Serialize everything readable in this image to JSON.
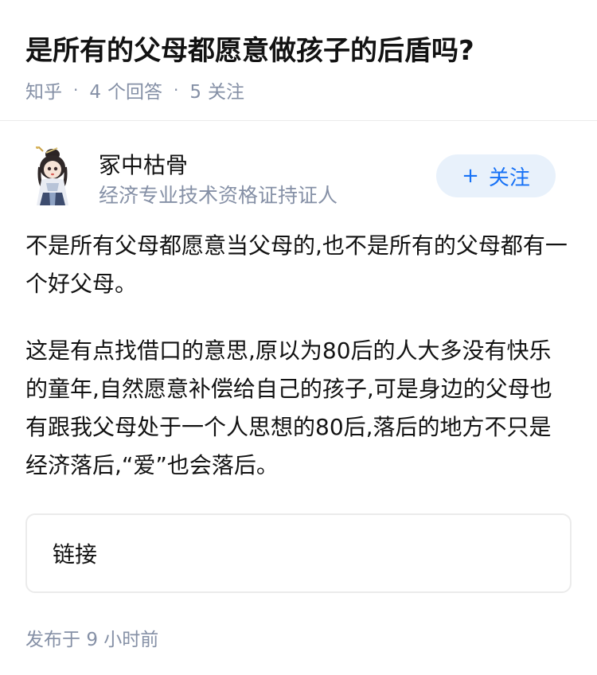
{
  "question": {
    "title": "是所有的父母都愿意做孩子的后盾吗?",
    "source": "知乎",
    "answer_count": "4",
    "answer_label": "个回答",
    "follow_count": "5",
    "follow_label": "关注"
  },
  "author": {
    "name": "冢中枯骨",
    "headline": "经济专业技术资格证持证人",
    "follow_button_label": "关注",
    "follow_button_icon": "plus-icon",
    "avatar_icon": "avatar-icon"
  },
  "answer": {
    "paragraphs": [
      "不是所有父母都愿意当父母的,也不是所有的父母都有一个好父母。",
      "这是有点找借口的意思,原以为80后的人大多没有快乐的童年,自然愿意补偿给自己的孩子,可是身边的父母也有跟我父母处于一个人思想的80后,落后的地方不只是经济落后,“爱”也会落后。"
    ]
  },
  "link_card": {
    "label": "链接"
  },
  "footer": {
    "publish_prefix": "发布于",
    "publish_time": "9 小时前"
  },
  "colors": {
    "accent": "#1772f6",
    "meta_gray": "#8590a6",
    "follow_bg": "#e8f1fb"
  }
}
